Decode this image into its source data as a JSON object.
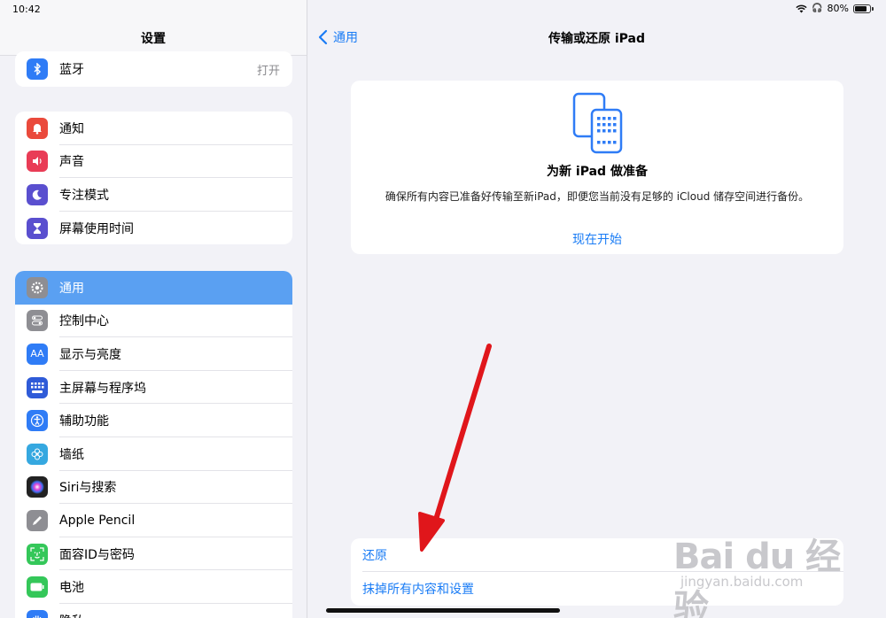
{
  "status_bar": {
    "time": "10:42",
    "battery": "80%"
  },
  "sidebar": {
    "title": "设置",
    "group1": [
      {
        "label": "蓝牙",
        "value": "打开",
        "icon": "bluetooth-icon",
        "color": "#2f7cf6"
      }
    ],
    "group2": [
      {
        "label": "通知",
        "icon": "bell-icon",
        "color": "#ea4a3c"
      },
      {
        "label": "声音",
        "icon": "speaker-icon",
        "color": "#e93c56"
      },
      {
        "label": "专注模式",
        "icon": "moon-icon",
        "color": "#5a4fcf"
      },
      {
        "label": "屏幕使用时间",
        "icon": "hourglass-icon",
        "color": "#5a4fcf"
      }
    ],
    "group3": [
      {
        "label": "通用",
        "icon": "gear-icon",
        "color": "#8e8e93",
        "selected": true
      },
      {
        "label": "控制中心",
        "icon": "toggles-icon",
        "color": "#8e8e93"
      },
      {
        "label": "显示与亮度",
        "icon": "text-size-icon",
        "color": "#2f7cf6"
      },
      {
        "label": "主屏幕与程序坞",
        "icon": "grid-icon",
        "color": "#2f5bd8"
      },
      {
        "label": "辅助功能",
        "icon": "accessibility-icon",
        "color": "#2f7cf6"
      },
      {
        "label": "墙纸",
        "icon": "flower-icon",
        "color": "#35a8e0"
      },
      {
        "label": "Siri与搜索",
        "icon": "siri-icon",
        "color": "#222222"
      },
      {
        "label": "Apple Pencil",
        "icon": "pencil-icon",
        "color": "#8e8e93"
      },
      {
        "label": "面容ID与密码",
        "icon": "faceid-icon",
        "color": "#34c759"
      },
      {
        "label": "电池",
        "icon": "battery-icon",
        "color": "#34c759"
      },
      {
        "label": "隐私",
        "icon": "hand-icon",
        "color": "#2f7cf6"
      }
    ]
  },
  "main": {
    "back_label": "通用",
    "title": "传输或还原 iPad",
    "card": {
      "icon": "ipad-transfer-icon",
      "title": "为新 iPad 做准备",
      "description": "确保所有内容已准备好传输至新iPad，即便您当前没有足够的 iCloud 储存空间进行备份。",
      "action": "现在开始"
    },
    "bottom_options": [
      "还原",
      "抹掉所有内容和设置"
    ]
  },
  "watermark": {
    "logo": "Bai du 经验",
    "url": "jingyan.baidu.com"
  },
  "colors": {
    "accent": "#1a7cf5",
    "selected": "#5aa0f2",
    "annotation_arrow": "#e0161b"
  }
}
